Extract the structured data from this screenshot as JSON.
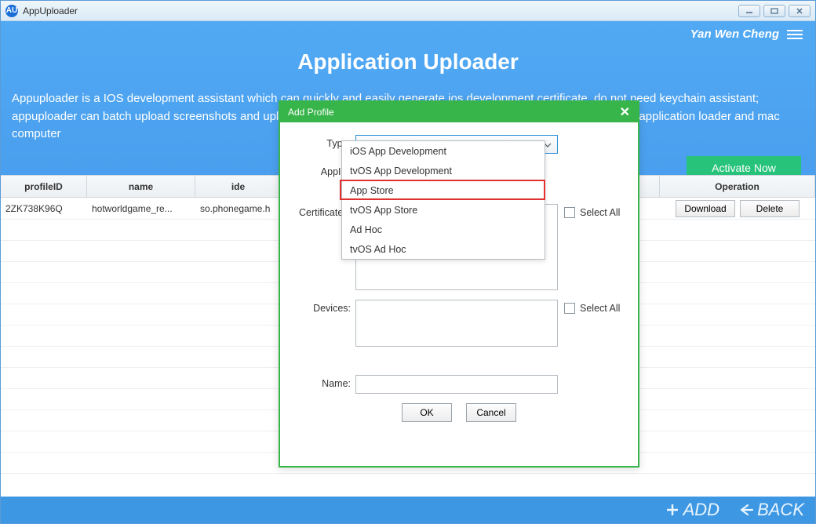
{
  "titlebar": {
    "app_name": "AppUploader"
  },
  "user": {
    "name": "Yan Wen Cheng"
  },
  "header": {
    "title": "Application Uploader",
    "description": "Appuploader is a IOS development assistant which can quickly and easily generate ios development certificate, do not need keychain assistant; appuploader can batch upload screenshots and upload IPA file to Apple store on the windows, linux or mac, do not need application loader and mac computer"
  },
  "buttons": {
    "activate": "Activate Now"
  },
  "table": {
    "headers": {
      "profileID": "profileID",
      "name": "name",
      "identifier": "ide",
      "operation": "Operation"
    },
    "rows": [
      {
        "profileID": "2ZK738K96Q",
        "name": "hotworldgame_re...",
        "identifier": "so.phonegame.h"
      }
    ],
    "op": {
      "download": "Download",
      "delete": "Delete"
    }
  },
  "footer": {
    "add": "ADD",
    "back": "BACK"
  },
  "modal": {
    "title": "Add Profile",
    "labels": {
      "type": "Type:",
      "appid": "AppID:",
      "certificates": "Certificates:",
      "devices": "Devices:",
      "name": "Name:",
      "select_all": "Select All"
    },
    "buttons": {
      "ok": "OK",
      "cancel": "Cancel"
    },
    "name_value": ""
  },
  "dropdown": {
    "items": [
      "iOS App Development",
      "tvOS App Development",
      "App Store",
      "tvOS App Store",
      "Ad Hoc",
      "tvOS Ad Hoc"
    ]
  }
}
